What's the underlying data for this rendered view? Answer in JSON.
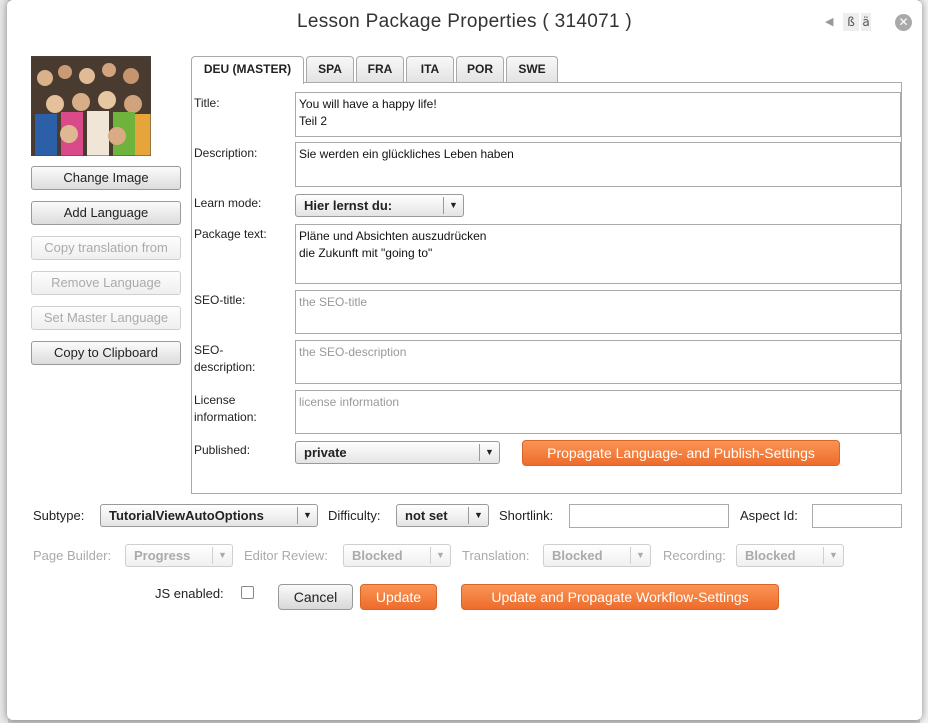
{
  "dialog": {
    "title": "Lesson Package Properties ( 314071 )",
    "nav_prev_glyph": "◀",
    "char_buttons": [
      "ß",
      "ä"
    ],
    "close_glyph": "✕"
  },
  "sidebar": {
    "change_image": "Change Image",
    "add_language": "Add Language",
    "copy_translation": "Copy translation from",
    "remove_language": "Remove Language",
    "set_master_language": "Set Master Language",
    "copy_clipboard": "Copy to Clipboard"
  },
  "tabs": [
    "DEU (MASTER)",
    "SPA",
    "FRA",
    "ITA",
    "POR",
    "SWE"
  ],
  "form": {
    "title_label": "Title:",
    "title_value": "You will have a happy life!\nTeil 2",
    "description_label": "Description:",
    "description_value": "Sie werden ein glückliches Leben haben",
    "learn_mode_label": "Learn mode:",
    "learn_mode_value": "Hier lernst du:",
    "package_text_label": "Package text:",
    "package_text_value": "Pläne und Absichten auszudrücken\ndie Zukunft mit \"going to\"",
    "seo_title_label": "SEO-title:",
    "seo_title_placeholder": "the SEO-title",
    "seo_desc_label": "SEO-\ndescription:",
    "seo_desc_placeholder": "the SEO-description",
    "license_label": "License\ninformation:",
    "license_placeholder": "license information",
    "published_label": "Published:",
    "published_value": "private",
    "propagate_button": "Propagate Language- and Publish-Settings"
  },
  "bottom": {
    "subtype_label": "Subtype:",
    "subtype_value": "TutorialViewAutoOptions",
    "difficulty_label": "Difficulty:",
    "difficulty_value": "not set",
    "shortlink_label": "Shortlink:",
    "aspect_label": "Aspect Id:",
    "page_builder_label": "Page Builder:",
    "page_builder_value": "Progress",
    "editor_review_label": "Editor Review:",
    "editor_review_value": "Blocked",
    "translation_label": "Translation:",
    "translation_value": "Blocked",
    "recording_label": "Recording:",
    "recording_value": "Blocked",
    "js_label": "JS enabled:",
    "cancel": "Cancel",
    "update": "Update",
    "update_propagate": "Update and Propagate Workflow-Settings"
  },
  "dropdown_glyph": "▼",
  "colors": {
    "accent_orange": "#ee6c2b",
    "border_gray": "#aaaaaa",
    "placeholder_gray": "#999999"
  }
}
